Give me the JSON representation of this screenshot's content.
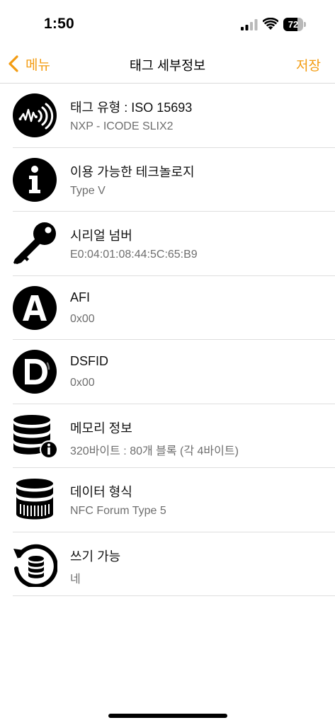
{
  "status_bar": {
    "time": "1:50",
    "battery_level": "72"
  },
  "nav": {
    "back_label": "메뉴",
    "title": "태그 세부정보",
    "save_label": "저장"
  },
  "items": [
    {
      "icon": "nfc-waveform-icon",
      "title": "태그 유형 : ISO 15693",
      "value": "NXP - ICODE SLIX2"
    },
    {
      "icon": "info-icon",
      "title": "이용 가능한 테크놀로지",
      "value": "Type V"
    },
    {
      "icon": "key-icon",
      "title": "시리얼 넘버",
      "value": "E0:04:01:08:44:5C:65:B9"
    },
    {
      "icon": "letter-a-icon",
      "title": "AFI",
      "value": "0x00"
    },
    {
      "icon": "letter-d-icon",
      "title": "DSFID",
      "value": "0x00"
    },
    {
      "icon": "database-info-icon",
      "title": "메모리 정보",
      "value": "320바이트 : 80개 블록 (각 4바이트)"
    },
    {
      "icon": "database-format-icon",
      "title": "데이터 형식",
      "value": "NFC Forum Type 5"
    },
    {
      "icon": "database-rewrite-icon",
      "title": "쓰기 가능",
      "value": "네"
    }
  ],
  "colors": {
    "accent": "#f39c12",
    "secondary_text": "#6e6e6e",
    "divider": "#dedede"
  }
}
